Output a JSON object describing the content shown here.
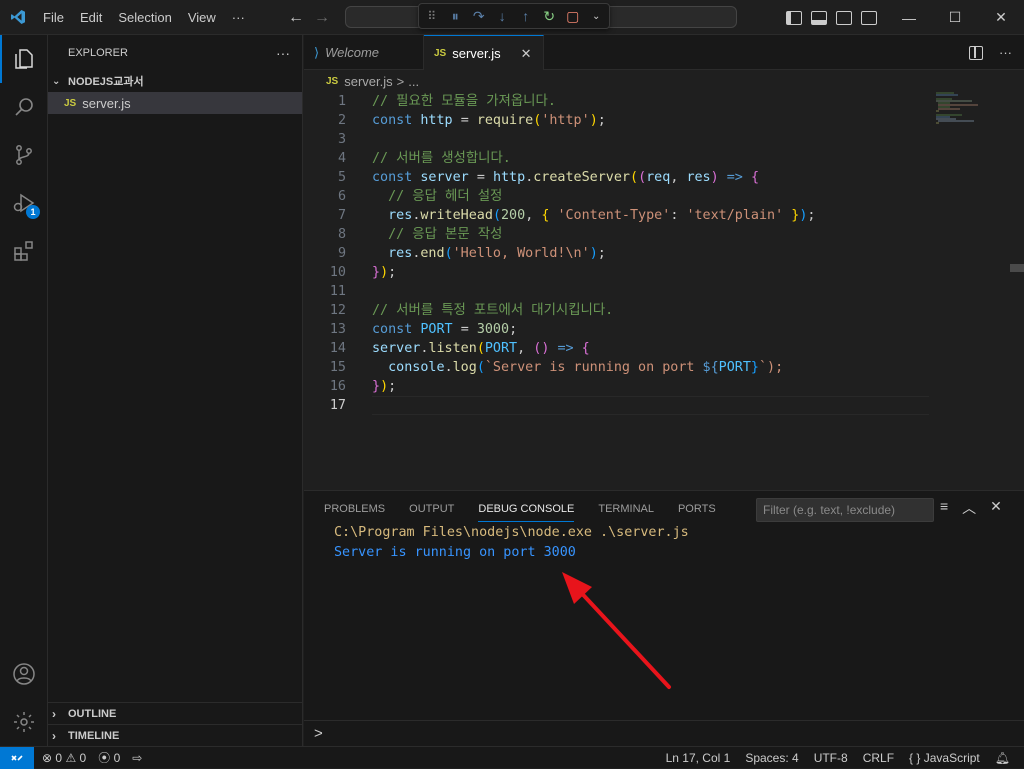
{
  "menu": [
    "File",
    "Edit",
    "Selection",
    "View",
    "···"
  ],
  "explorer": {
    "header": "EXPLORER",
    "folder": "NODEJS교과서",
    "files": [
      "server.js"
    ],
    "outline": "OUTLINE",
    "timeline": "TIMELINE"
  },
  "activity": {
    "debug_badge": "1"
  },
  "tabs": [
    {
      "label": "Welcome",
      "active": false
    },
    {
      "label": "server.js",
      "active": true
    }
  ],
  "breadcrumb": {
    "file": "server.js",
    "sep": ">",
    "rest": "..."
  },
  "editor": {
    "current_line": 17,
    "lines": [
      "// 필요한 모듈을 가져옵니다.",
      "const http = require('http');",
      "",
      "// 서버를 생성합니다.",
      "const server = http.createServer((req, res) => {",
      "  // 응답 헤더 설정",
      "  res.writeHead(200, { 'Content-Type': 'text/plain' });",
      "  // 응답 본문 작성",
      "  res.end('Hello, World!\\n');",
      "});",
      "",
      "// 서버를 특정 포트에서 대기시킵니다.",
      "const PORT = 3000;",
      "server.listen(PORT, () => {",
      "  console.log(`Server is running on port ${PORT}`);",
      "});",
      ""
    ]
  },
  "panel": {
    "tabs": [
      "PROBLEMS",
      "OUTPUT",
      "DEBUG CONSOLE",
      "TERMINAL",
      "PORTS"
    ],
    "active_tab": "DEBUG CONSOLE",
    "filter_placeholder": "Filter (e.g. text, !exclude)",
    "output": [
      {
        "text": "C:\\Program Files\\nodejs\\node.exe .\\server.js",
        "color": "#d7ba7d"
      },
      {
        "text": "Server is running on port 3000",
        "color": "#3794ff"
      }
    ],
    "prompt": ">"
  },
  "statusbar": {
    "errors": "0",
    "warnings": "0",
    "ports": "0",
    "position": "Ln 17, Col 1",
    "spaces": "Spaces: 4",
    "encoding": "UTF-8",
    "eol": "CRLF",
    "language": "JavaScript",
    "language_icon": "{ }"
  },
  "colors": {
    "accent": "#0078d4",
    "arrow": "#e8141b"
  }
}
